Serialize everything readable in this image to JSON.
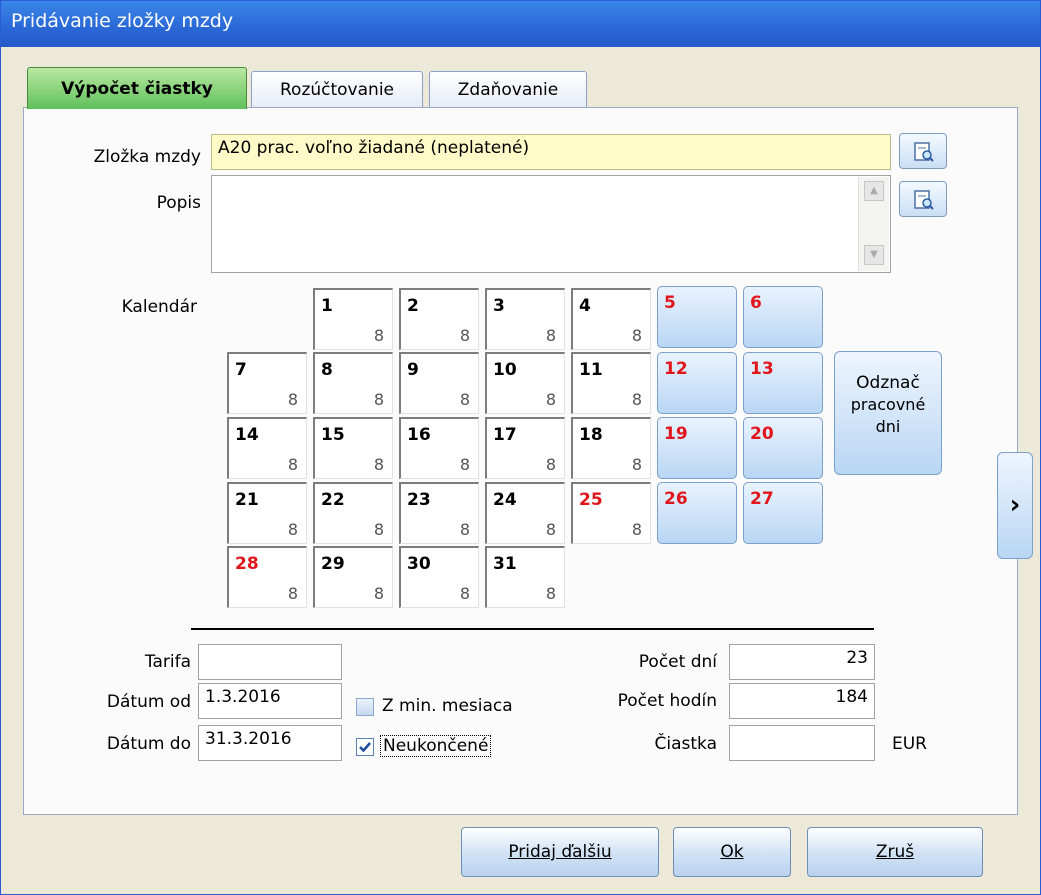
{
  "window": {
    "title": "Pridávanie zložky mzdy"
  },
  "tabs": [
    "Výpočet čiastky",
    "Rozúčtovanie",
    "Zdaňovanie"
  ],
  "form": {
    "zlozka_label": "Zložka mzdy",
    "zlozka_value": "A20  prac. voľno žiadané (neplatené)",
    "popis_label": "Popis",
    "popis_value": "",
    "kalendar_label": "Kalendár"
  },
  "calendar": {
    "weekdays": [
      {
        "d": "1",
        "h": "8"
      },
      {
        "d": "2",
        "h": "8"
      },
      {
        "d": "3",
        "h": "8"
      },
      {
        "d": "4",
        "h": "8"
      },
      {
        "d": "7",
        "h": "8"
      },
      {
        "d": "8",
        "h": "8"
      },
      {
        "d": "9",
        "h": "8"
      },
      {
        "d": "10",
        "h": "8"
      },
      {
        "d": "11",
        "h": "8"
      },
      {
        "d": "14",
        "h": "8"
      },
      {
        "d": "15",
        "h": "8"
      },
      {
        "d": "16",
        "h": "8"
      },
      {
        "d": "17",
        "h": "8"
      },
      {
        "d": "18",
        "h": "8"
      },
      {
        "d": "21",
        "h": "8"
      },
      {
        "d": "22",
        "h": "8"
      },
      {
        "d": "23",
        "h": "8"
      },
      {
        "d": "24",
        "h": "8"
      },
      {
        "d": "25",
        "h": "8",
        "holiday": true
      },
      {
        "d": "28",
        "h": "8",
        "holiday": true
      },
      {
        "d": "29",
        "h": "8"
      },
      {
        "d": "30",
        "h": "8"
      },
      {
        "d": "31",
        "h": "8"
      }
    ],
    "weekends": [
      "5",
      "6",
      "12",
      "13",
      "19",
      "20",
      "26",
      "27"
    ],
    "mark_workdays_button": [
      "Odznač",
      "pracovné",
      "dni"
    ],
    "next_arrow": "›"
  },
  "bottom": {
    "tarifa_label": "Tarifa",
    "tarifa_value": "",
    "datum_od_label": "Dátum od",
    "datum_od_value": "1.3.2016",
    "datum_do_label": "Dátum do",
    "datum_do_value": "31.3.2016",
    "z_min_mesiaca_label": "Z min. mesiaca",
    "z_min_mesiaca_checked": false,
    "neukoncene_label": "Neukončené",
    "neukoncene_checked": true,
    "pocet_dni_label": "Počet dní",
    "pocet_dni_value": "23",
    "pocet_hodin_label": "Počet hodín",
    "pocet_hodin_value": "184",
    "ciastka_label": "Čiastka",
    "ciastka_value": "",
    "currency": "EUR"
  },
  "buttons": {
    "add_next": "Pridaj ďalšiu",
    "ok": "Ok",
    "cancel": "Zruš"
  }
}
